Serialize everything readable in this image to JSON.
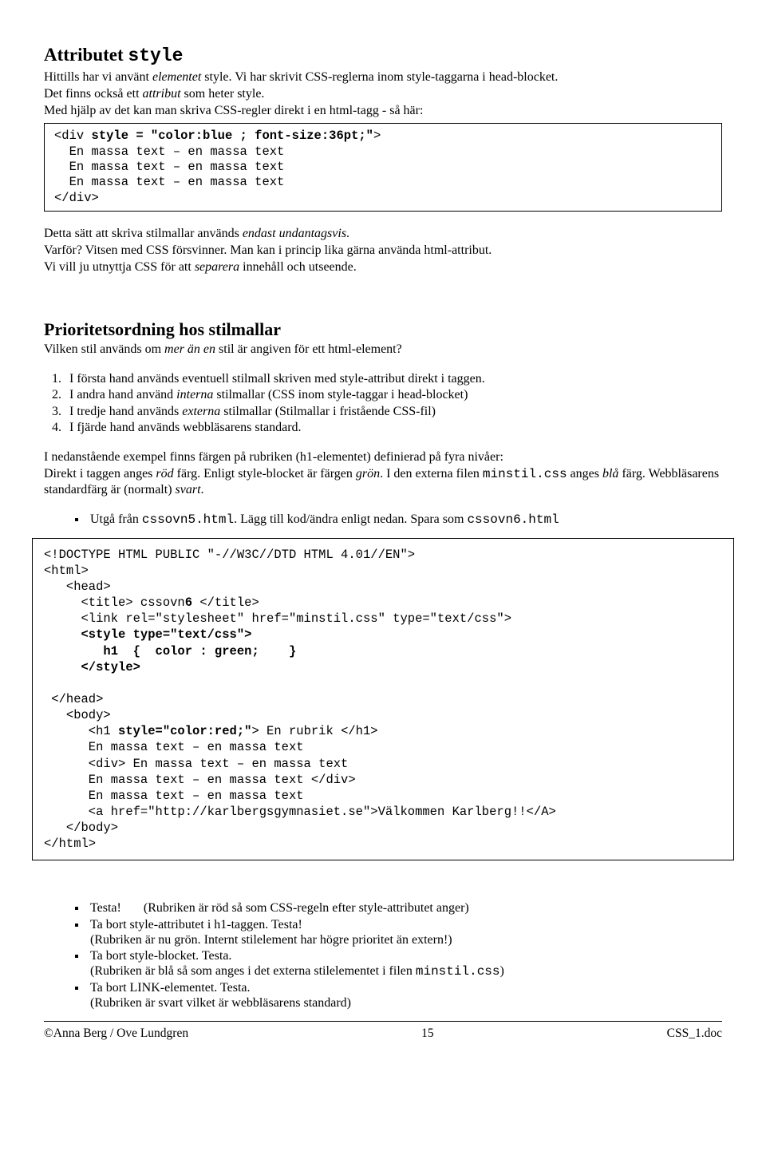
{
  "section1": {
    "title_prefix": "Attributet ",
    "title_code": "style",
    "p1a": "Hittills har vi använt ",
    "p1b": "elementet",
    "p1c": " style. Vi har skrivit CSS-reglerna inom style-taggarna i head-blocket.",
    "p2a": "Det finns också ett ",
    "p2b": "attribut",
    "p2c": " som heter style.",
    "p3": "Med hjälp av det kan man skriva CSS-regler direkt i en html-tagg - så här:",
    "code1_l1a": "<div ",
    "code1_l1b": "style = \"color:blue ; font-size:36pt;\"",
    "code1_l1c": ">",
    "code1_l2": "  En massa text – en massa text",
    "code1_l3": "  En massa text – en massa text",
    "code1_l4": "  En massa text – en massa text",
    "code1_l5": "</div>",
    "p4a": "Detta sätt att skriva stilmallar används ",
    "p4b": "endast undantagsvis",
    "p4c": ".",
    "p5": "Varför? Vitsen med CSS försvinner. Man kan i princip lika gärna använda html-attribut.",
    "p6a": "Vi vill ju utnyttja CSS för att ",
    "p6b": "separera",
    "p6c": " innehåll och utseende."
  },
  "section2": {
    "title": "Prioritetsordning hos stilmallar",
    "intro_a": "Vilken stil används om ",
    "intro_b": "mer än en",
    "intro_c": " stil är angiven för ett html-element?",
    "li1": "I första hand används eventuell stilmall skriven med style-attribut direkt i taggen.",
    "li2a": "I andra hand använd ",
    "li2b": "interna",
    "li2c": " stilmallar   (CSS inom style-taggar i head-blocket)",
    "li3a": "I tredje hand används ",
    "li3b": "externa",
    "li3c": " stilmallar   (Stilmallar i fristående CSS-fil)",
    "li4": "I fjärde hand används webbläsarens standard.",
    "p1": "I nedanstående exempel finns färgen på rubriken (h1-elementet) definierad på fyra nivåer:",
    "p2a": "Direkt i taggen anges ",
    "p2b": "röd",
    "p2c": " färg. Enligt style-blocket är färgen ",
    "p2d": "grön",
    "p2e": ".  I den externa filen ",
    "p2f": "minstil.css",
    "p2g": " anges ",
    "p2h": "blå",
    "p2i": " färg.  Webbläsarens standardfärg är (normalt) ",
    "p2j": "svart",
    "p2k": ".",
    "bullet_a": "Utgå från ",
    "bullet_b": "cssovn5.html",
    "bullet_c": ".  Lägg till kod/ändra enligt nedan.  Spara som ",
    "bullet_d": "cssovn6.html"
  },
  "code2": {
    "l1": "<!DOCTYPE HTML PUBLIC \"-//W3C//DTD HTML 4.01//EN\">",
    "l2": "<html>",
    "l3": "   <head>",
    "l4a": "     <title> cssovn",
    "l4b": "6",
    "l4c": " </title>",
    "l5": "     <link rel=\"stylesheet\" href=\"minstil.css\" type=\"text/css\">",
    "l6": "     <style type=\"text/css\">",
    "l7": "        h1  {  color : green;    }",
    "l8": "     </style>",
    "blank": " ",
    "l9": " </head>",
    "l10": "   <body>",
    "l11a": "      <h1 ",
    "l11b": "style=\"color:red;\"",
    "l11c": "> En rubrik </h1>",
    "l12": "      En massa text – en massa text",
    "l13": "      <div> En massa text – en massa text",
    "l14": "      En massa text – en massa text </div>",
    "l15": "      En massa text – en massa text",
    "l16": "      <a href=\"http://karlbergsgymnasiet.se\">Välkommen Karlberg!!</A>",
    "l17": "   </body>",
    "l18": "</html>"
  },
  "bullets": {
    "b1": "Testa!       (Rubriken är röd så som CSS-regeln efter style-attributet anger)",
    "b2": "Ta bort style-attributet i h1-taggen. Testa!",
    "b2sub": "(Rubriken är nu grön. Internt stilelement har högre prioritet än extern!)",
    "b3": "Ta bort style-blocket.  Testa.",
    "b3sub_a": " (Rubriken är blå så som anges i det externa stilelementet i filen ",
    "b3sub_b": "minstil.css",
    "b3sub_c": ")",
    "b4": "Ta bort LINK-elementet.  Testa.",
    "b4sub": " (Rubriken är svart vilket är webbläsarens standard)"
  },
  "footer": {
    "left": "©Anna Berg / Ove Lundgren",
    "center": "15",
    "right": "CSS_1.doc"
  }
}
